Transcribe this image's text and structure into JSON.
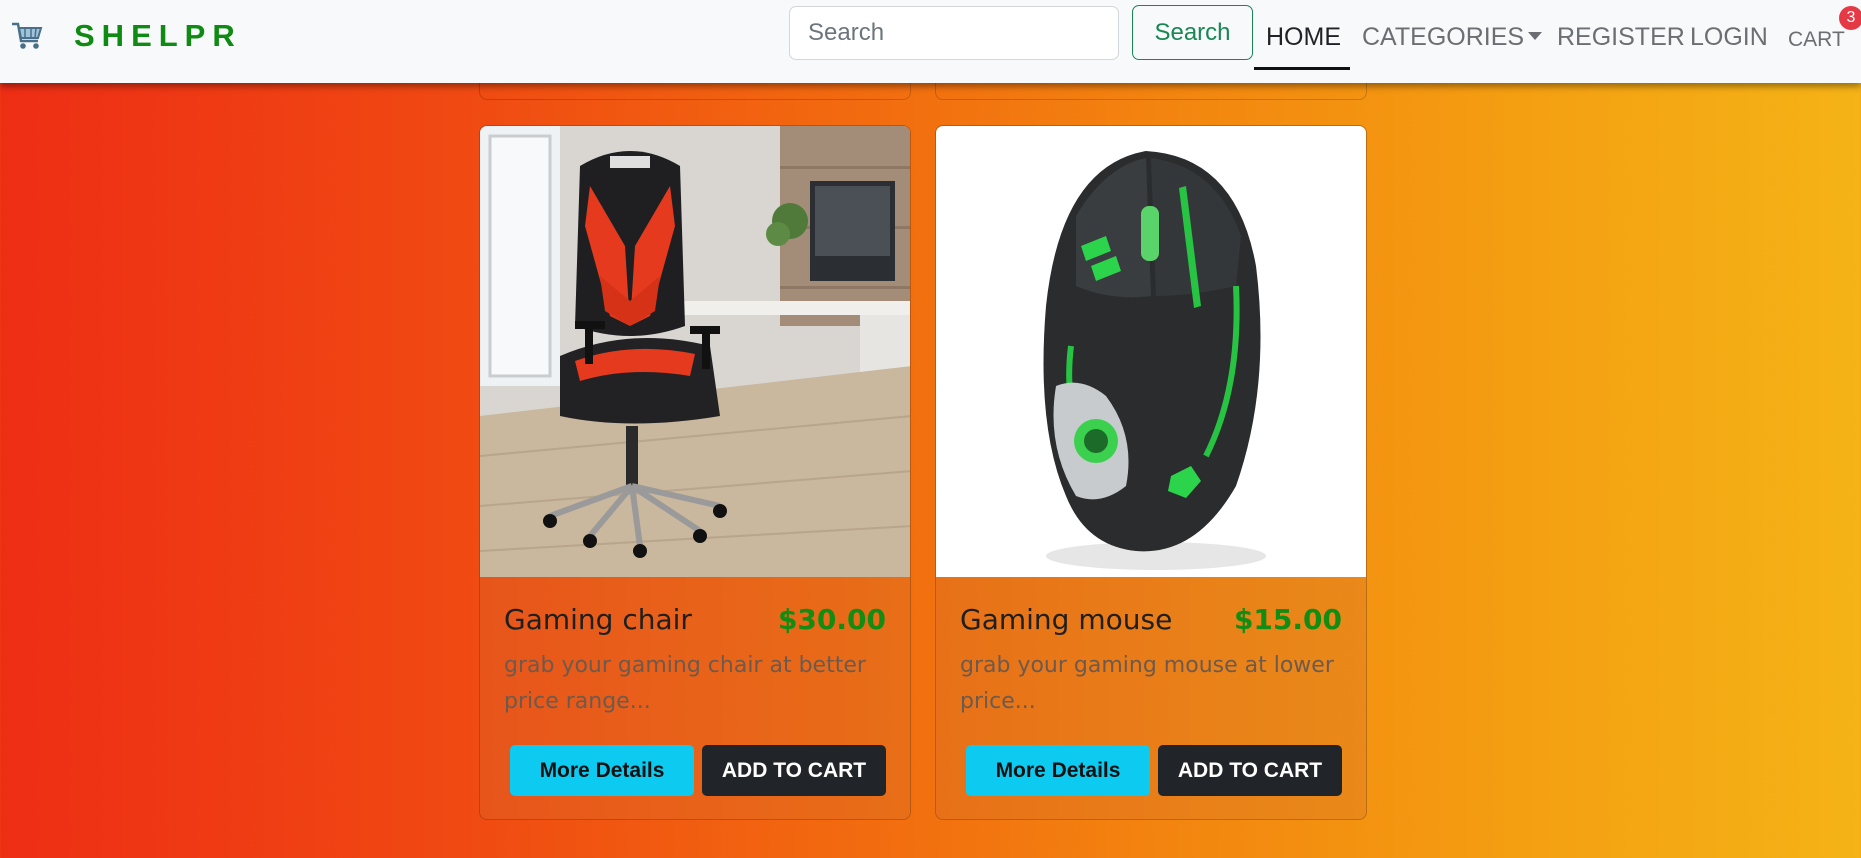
{
  "brand": {
    "name": "SHELPR",
    "icon": "shopping-cart-icon"
  },
  "search": {
    "placeholder": "Search",
    "button_label": "Search"
  },
  "nav": {
    "home": "HOME",
    "categories": "CATEGORIES",
    "register": "REGISTER",
    "login": "LOGIN",
    "cart": "CART",
    "cart_count": "3",
    "active": "HOME"
  },
  "products": [
    {
      "name": "Gaming chair",
      "price": "$30.00",
      "description": "grab your gaming chair at better price range...",
      "details_label": "More Details",
      "add_label": "ADD TO CART",
      "image": "gaming-chair-image"
    },
    {
      "name": "Gaming mouse",
      "price": "$15.00",
      "description": "grab your gaming mouse at lower price...",
      "details_label": "More Details",
      "add_label": "ADD TO CART",
      "image": "gaming-mouse-image"
    }
  ],
  "colors": {
    "brand": "#0f8a12",
    "price": "#128c12",
    "details_button": "#0dcaf0",
    "cart_button": "#212529",
    "badge": "#e63946"
  }
}
